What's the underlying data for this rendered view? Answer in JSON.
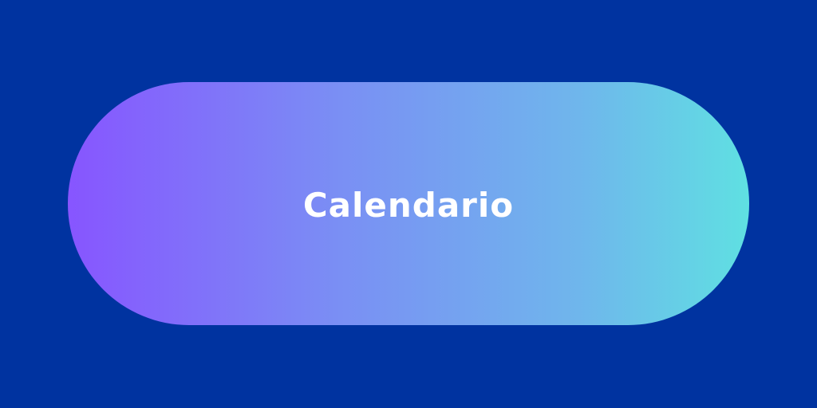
{
  "button": {
    "label": "Calendario"
  },
  "colors": {
    "background": "#0033a0",
    "gradient_start": "#8755ff",
    "gradient_end": "#5fe0e2",
    "label_color": "#ffffff"
  }
}
